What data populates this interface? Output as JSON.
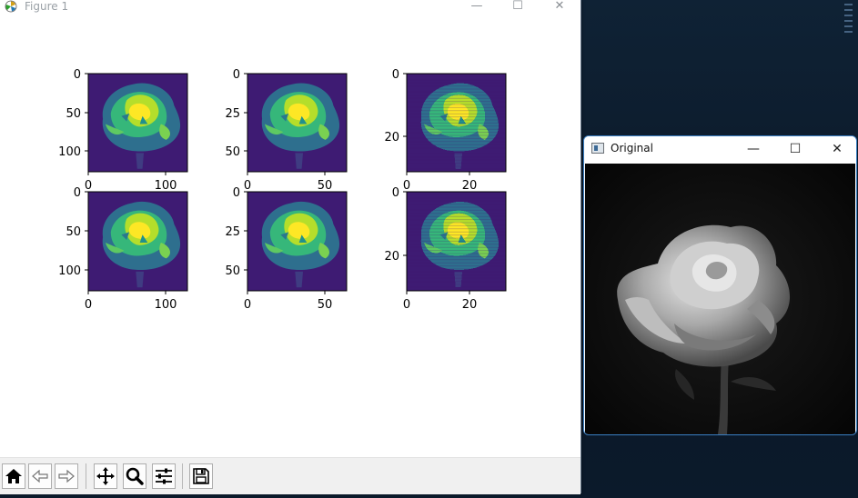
{
  "figure_window": {
    "title": "Figure 1",
    "controls": {
      "minimize": "—",
      "maximize": "☐",
      "close": "✕"
    }
  },
  "toolbar": {
    "buttons": [
      {
        "name": "home",
        "icon": "home-icon"
      },
      {
        "name": "back",
        "icon": "back-arrow-icon"
      },
      {
        "name": "forward",
        "icon": "forward-arrow-icon"
      },
      {
        "name": "pan",
        "icon": "pan-icon"
      },
      {
        "name": "zoom",
        "icon": "zoom-icon"
      },
      {
        "name": "configure",
        "icon": "sliders-icon"
      },
      {
        "name": "save",
        "icon": "save-icon"
      }
    ]
  },
  "subplots": [
    {
      "yticks": [
        "0",
        "50",
        "100"
      ],
      "xticks": [
        "0",
        "100"
      ]
    },
    {
      "yticks": [
        "0",
        "25",
        "50"
      ],
      "xticks": [
        "0",
        "50"
      ]
    },
    {
      "yticks": [
        "0",
        "20"
      ],
      "xticks": [
        "0",
        "20"
      ]
    },
    {
      "yticks": [
        "0",
        "50",
        "100"
      ],
      "xticks": [
        "0",
        "100"
      ]
    },
    {
      "yticks": [
        "0",
        "25",
        "50"
      ],
      "xticks": [
        "0",
        "50"
      ]
    },
    {
      "yticks": [
        "0",
        "20"
      ],
      "xticks": [
        "0",
        "20"
      ]
    }
  ],
  "original_window": {
    "title": "Original",
    "controls": {
      "minimize": "—",
      "maximize": "☐",
      "close": "✕"
    }
  },
  "colors": {
    "viridis_bg": "#3e1b73",
    "viridis_yellow": "#e3e21c",
    "viridis_teal": "#1f9c89"
  }
}
